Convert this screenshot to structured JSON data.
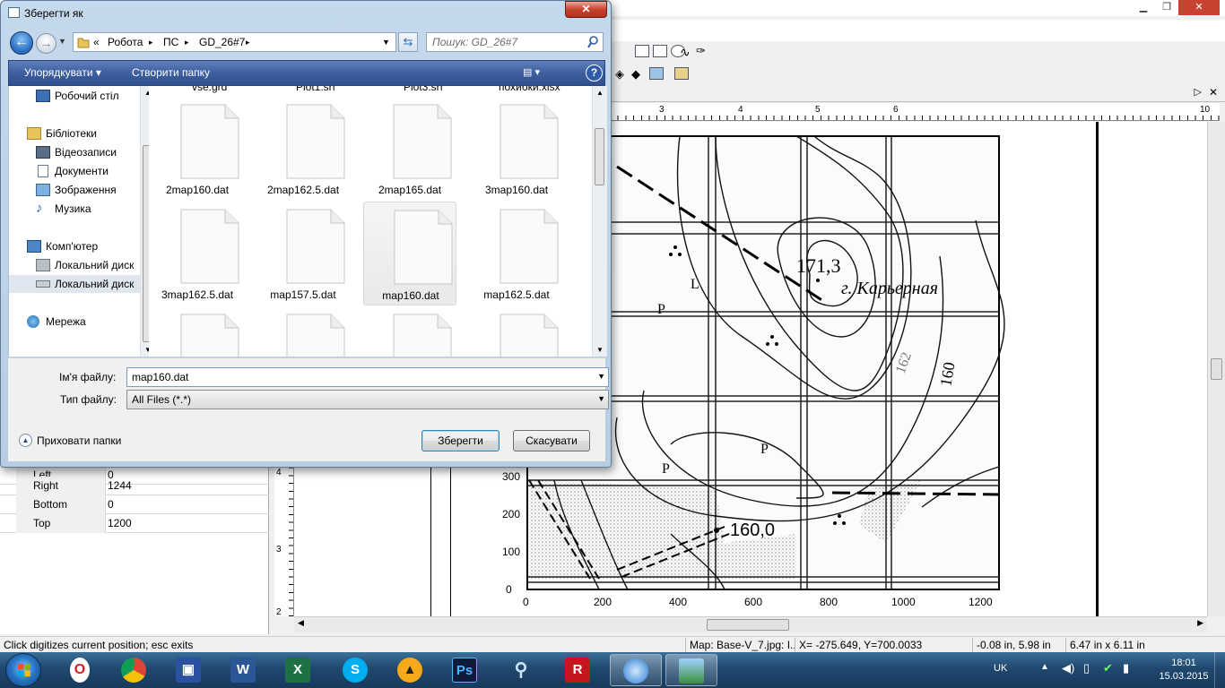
{
  "dialog": {
    "title": "Зберегти як",
    "close": "✕",
    "breadcrumb": [
      "«",
      "Робота",
      "ПС",
      "GD_26#7"
    ],
    "search_placeholder": "Пошук: GD_26#7",
    "commands": {
      "organize": "Упорядкувати ▾",
      "new_folder": "Створити папку",
      "help": "?"
    },
    "nav_items": [
      "Робочий стіл",
      "Бібліотеки",
      "Відеозаписи",
      "Документи",
      "Зображення",
      "Музика",
      "Комп'ютер",
      "Локальний диск",
      "Локальний диск",
      "Мережа"
    ],
    "partial_top_names": [
      "vse.grd",
      "Plot1.srf",
      "Plot3.srf",
      "похибки.xlsx"
    ],
    "files": [
      "2map160.dat",
      "2map162.5.dat",
      "2map165.dat",
      "3map160.dat",
      "3map162.5.dat",
      "map157.5.dat",
      "map160.dat",
      "map162.5.dat"
    ],
    "filename_label": "Ім'я файлу:",
    "filename_value": "map160.dat",
    "filetype_label": "Тип файлу:",
    "filetype_value": "All Files (*.*)",
    "hide_folders": "Приховати папки",
    "save": "Зберегти",
    "cancel": "Скасувати"
  },
  "app": {
    "props": [
      {
        "key": "Left",
        "value": "0"
      },
      {
        "key": "Right",
        "value": "1244"
      },
      {
        "key": "Bottom",
        "value": "0"
      },
      {
        "key": "Top",
        "value": "1200"
      }
    ],
    "ruler_top": [
      "3",
      "4",
      "5",
      "6",
      "10"
    ],
    "ruler_left": [
      "4",
      "3",
      "2"
    ],
    "map": {
      "x_ticks": [
        "0",
        "200",
        "400",
        "600",
        "800",
        "1000",
        "1200"
      ],
      "y_ticks": [
        "0",
        "100",
        "200",
        "300"
      ],
      "labels": {
        "peak": "171,3",
        "name": "г. Карьерная",
        "spot": "160,0",
        "contour": "160",
        "contour2": "162"
      }
    }
  },
  "status": {
    "hint": "Click digitizes current position; esc exits",
    "map": "Map: Base-V_7.jpg: I...",
    "coords": "X= -275.649, Y=700.0033",
    "pos": "-0.08 in, 5.98 in",
    "size": "6.47 in x 6.11 in"
  },
  "taskbar": {
    "lang": "UK",
    "time": "18:01",
    "date": "15.03.2015"
  }
}
